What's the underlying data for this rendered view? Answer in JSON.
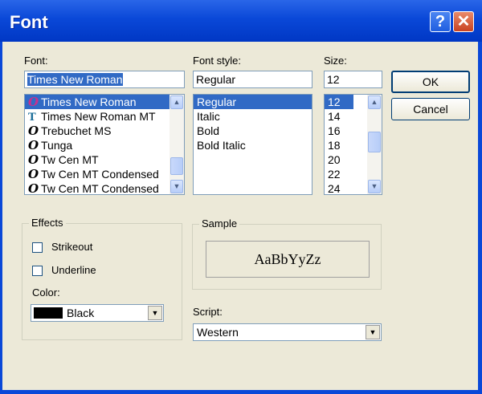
{
  "window": {
    "title": "Font",
    "help_glyph": "?",
    "close_glyph": "✕"
  },
  "font": {
    "label": "Font:",
    "value": "Times New Roman",
    "items": [
      {
        "icon": "O",
        "type": "opentype",
        "label": "Times New Roman"
      },
      {
        "icon": "T",
        "type": "truetype",
        "label": "Times New Roman MT"
      },
      {
        "icon": "O",
        "type": "opentype",
        "label": "Trebuchet MS"
      },
      {
        "icon": "O",
        "type": "opentype",
        "label": "Tunga"
      },
      {
        "icon": "O",
        "type": "opentype",
        "label": "Tw Cen MT"
      },
      {
        "icon": "O",
        "type": "opentype",
        "label": "Tw Cen MT Condensed"
      },
      {
        "icon": "O",
        "type": "opentype",
        "label": "Tw Cen MT Condensed"
      }
    ]
  },
  "style": {
    "label": "Font style:",
    "value": "Regular",
    "items": [
      "Regular",
      "Italic",
      "Bold",
      "Bold Italic"
    ]
  },
  "size": {
    "label": "Size:",
    "value": "12",
    "items": [
      "12",
      "14",
      "16",
      "18",
      "20",
      "22",
      "24"
    ]
  },
  "buttons": {
    "ok": "OK",
    "cancel": "Cancel"
  },
  "effects": {
    "legend": "Effects",
    "strikeout": "Strikeout",
    "underline": "Underline",
    "color_label": "Color:",
    "color_value": "Black",
    "color_swatch": "#000000"
  },
  "sample": {
    "legend": "Sample",
    "text": "AaBbYyZz"
  },
  "script": {
    "label": "Script:",
    "value": "Western"
  },
  "colors": {
    "title_bar": "#0a48d8",
    "selection": "#316ac5",
    "dialog_bg": "#ece9d8"
  }
}
